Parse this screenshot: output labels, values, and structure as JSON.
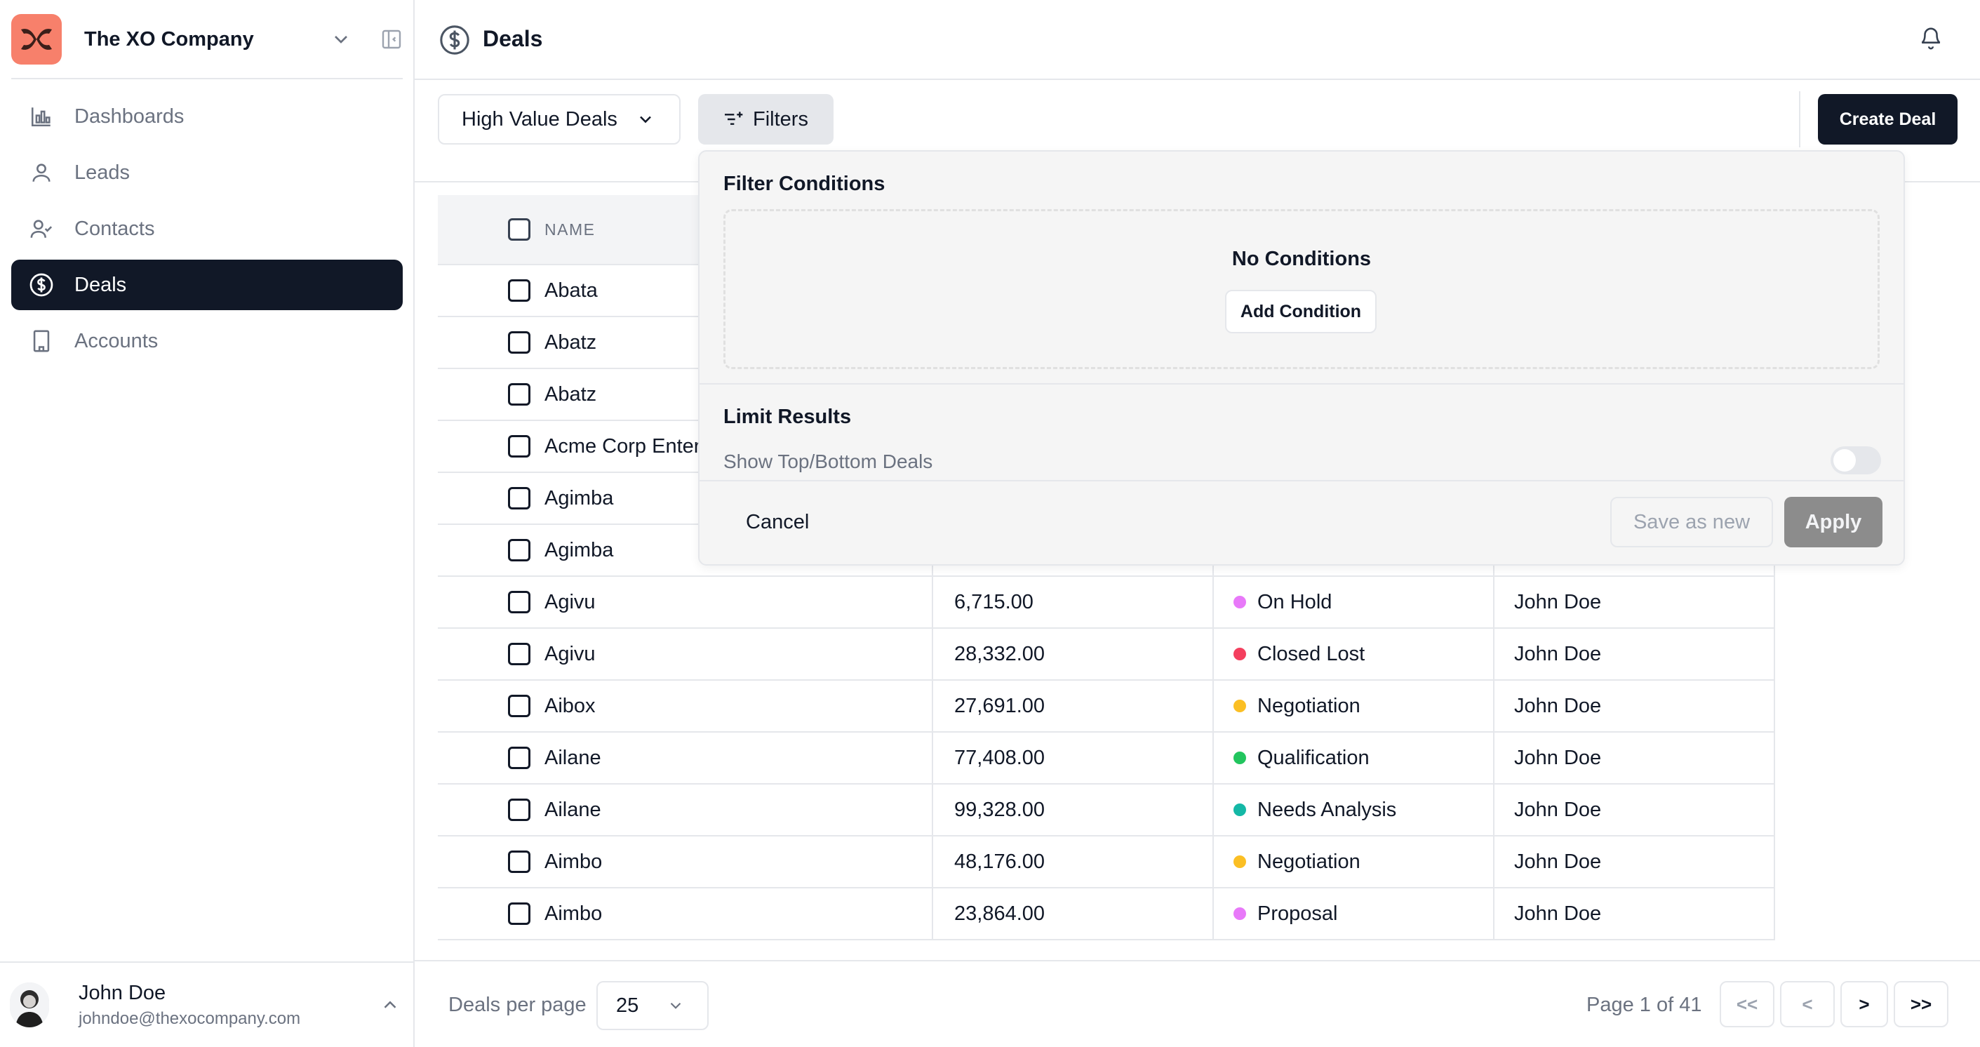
{
  "sidebar": {
    "company_name": "The XO Company",
    "nav": [
      {
        "label": "Dashboards",
        "icon": "bar-chart-icon",
        "active": false
      },
      {
        "label": "Leads",
        "icon": "user-icon",
        "active": false
      },
      {
        "label": "Contacts",
        "icon": "user-check-icon",
        "active": false
      },
      {
        "label": "Deals",
        "icon": "dollar-circle-icon",
        "active": true
      },
      {
        "label": "Accounts",
        "icon": "building-icon",
        "active": false
      }
    ],
    "user": {
      "name": "John Doe",
      "email": "johndoe@thexocompany.com"
    }
  },
  "header": {
    "title": "Deals"
  },
  "toolbar": {
    "view_label": "High Value Deals",
    "filters_label": "Filters",
    "create_label": "Create Deal"
  },
  "table": {
    "name_header": "NAME",
    "rows": [
      {
        "name": "Abata",
        "amount": "",
        "stage": "",
        "stage_color": "",
        "owner": ""
      },
      {
        "name": "Abatz",
        "amount": "",
        "stage": "",
        "stage_color": "",
        "owner": ""
      },
      {
        "name": "Abatz",
        "amount": "",
        "stage": "",
        "stage_color": "",
        "owner": ""
      },
      {
        "name": "Acme Corp Enter",
        "amount": "",
        "stage": "",
        "stage_color": "",
        "owner": ""
      },
      {
        "name": "Agimba",
        "amount": "",
        "stage": "",
        "stage_color": "",
        "owner": ""
      },
      {
        "name": "Agimba",
        "amount": "",
        "stage": "",
        "stage_color": "",
        "owner": ""
      },
      {
        "name": "Agivu",
        "amount": "6,715.00",
        "stage": "On Hold",
        "stage_color": "#e879f9",
        "owner": "John Doe"
      },
      {
        "name": "Agivu",
        "amount": "28,332.00",
        "stage": "Closed Lost",
        "stage_color": "#f43f5e",
        "owner": "John Doe"
      },
      {
        "name": "Aibox",
        "amount": "27,691.00",
        "stage": "Negotiation",
        "stage_color": "#fbbf24",
        "owner": "John Doe"
      },
      {
        "name": "Ailane",
        "amount": "77,408.00",
        "stage": "Qualification",
        "stage_color": "#22c55e",
        "owner": "John Doe"
      },
      {
        "name": "Ailane",
        "amount": "99,328.00",
        "stage": "Needs Analysis",
        "stage_color": "#14b8a6",
        "owner": "John Doe"
      },
      {
        "name": "Aimbo",
        "amount": "48,176.00",
        "stage": "Negotiation",
        "stage_color": "#fbbf24",
        "owner": "John Doe"
      },
      {
        "name": "Aimbo",
        "amount": "23,864.00",
        "stage": "Proposal",
        "stage_color": "#e879f9",
        "owner": "John Doe"
      }
    ]
  },
  "filter_popover": {
    "title": "Filter Conditions",
    "empty_text": "No Conditions",
    "add_condition_label": "Add Condition",
    "limit_title": "Limit Results",
    "toggle_label": "Show Top/Bottom Deals",
    "toggle_on": false,
    "cancel_label": "Cancel",
    "save_new_label": "Save as new",
    "apply_label": "Apply"
  },
  "footer": {
    "per_page_label": "Deals per page",
    "per_page_value": "25",
    "page_info": "Page 1 of 41",
    "first_label": "<<",
    "prev_label": "<",
    "next_label": ">",
    "last_label": ">>"
  }
}
